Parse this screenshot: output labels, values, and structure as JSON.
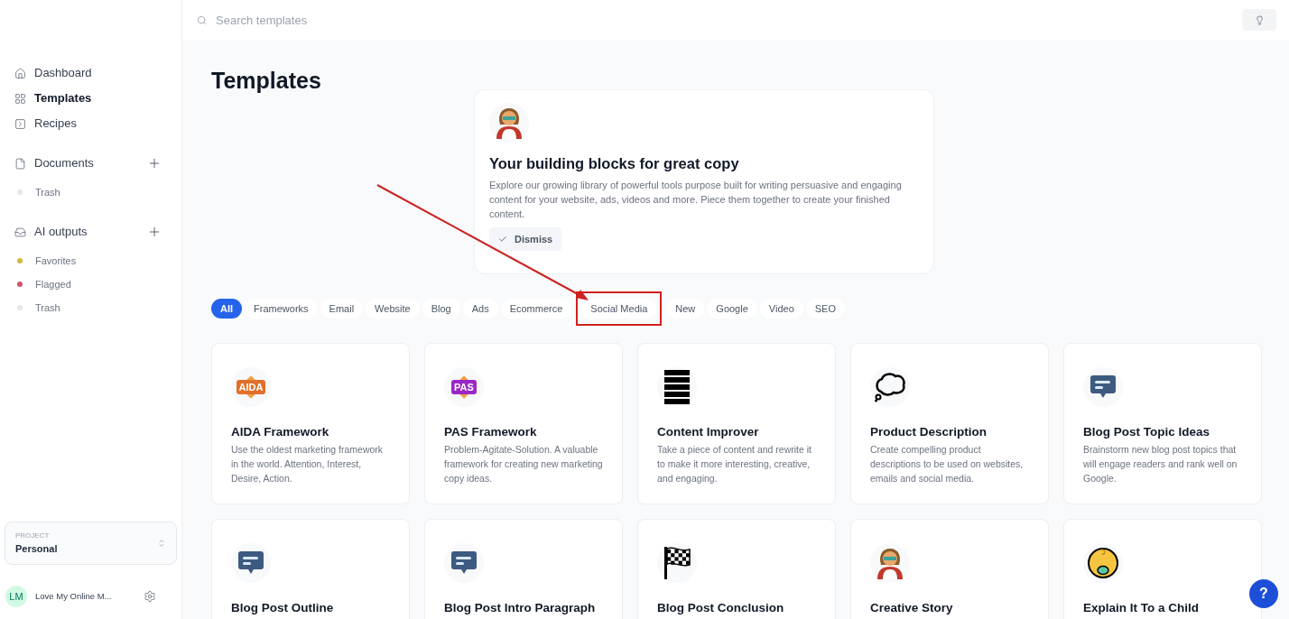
{
  "search": {
    "placeholder": "Search templates"
  },
  "sidebar": {
    "nav": [
      {
        "label": "Dashboard",
        "kind": "home",
        "selected": false
      },
      {
        "label": "Templates",
        "kind": "grid",
        "selected": true
      },
      {
        "label": "Recipes",
        "kind": "recipe",
        "selected": false
      }
    ],
    "sections": [
      {
        "title": "Documents",
        "kind": "file",
        "items": [
          {
            "label": "Trash",
            "color": "#e5e7eb"
          }
        ]
      },
      {
        "title": "AI outputs",
        "kind": "inbox",
        "items": [
          {
            "label": "Favorites",
            "color": "#d4b43c"
          },
          {
            "label": "Flagged",
            "color": "#d4536a"
          },
          {
            "label": "Trash",
            "color": "#e5e7eb"
          }
        ]
      }
    ],
    "project": {
      "label": "PROJECT",
      "value": "Personal"
    },
    "user": {
      "initials": "LM",
      "name": "Love My Online M..."
    }
  },
  "page_title": "Templates",
  "banner": {
    "title": "Your building blocks for great copy",
    "text": "Explore our growing library of powerful tools purpose built for writing persuasive and engaging content for your website, ads, videos and more. Piece them together to create your finished content.",
    "button": "Dismiss"
  },
  "filters": [
    {
      "label": "All",
      "selected": true,
      "highlighted": false
    },
    {
      "label": "Frameworks",
      "selected": false,
      "highlighted": false
    },
    {
      "label": "Email",
      "selected": false,
      "highlighted": false
    },
    {
      "label": "Website",
      "selected": false,
      "highlighted": false
    },
    {
      "label": "Blog",
      "selected": false,
      "highlighted": false
    },
    {
      "label": "Ads",
      "selected": false,
      "highlighted": false
    },
    {
      "label": "Ecommerce",
      "selected": false,
      "highlighted": false
    },
    {
      "label": "Social Media",
      "selected": false,
      "highlighted": true
    },
    {
      "label": "New",
      "selected": false,
      "highlighted": false
    },
    {
      "label": "Google",
      "selected": false,
      "highlighted": false
    },
    {
      "label": "Video",
      "selected": false,
      "highlighted": false
    },
    {
      "label": "SEO",
      "selected": false,
      "highlighted": false
    }
  ],
  "templates": [
    {
      "kind": "badge",
      "badge": "AIDA",
      "color": "#e0702a",
      "title": "AIDA Framework",
      "text": "Use the oldest marketing framework in the world. Attention, Interest, Desire, Action."
    },
    {
      "kind": "badge",
      "badge": "PAS",
      "color": "#9b27c9",
      "title": "PAS Framework",
      "text": "Problem-Agitate-Solution. A valuable framework for creating new marketing copy ideas."
    },
    {
      "kind": "lines",
      "title": "Content Improver",
      "text": "Take a piece of content and rewrite it to make it more interesting, creative, and engaging."
    },
    {
      "kind": "thought",
      "title": "Product Description",
      "text": "Create compelling product descriptions to be used on websites, emails and social media."
    },
    {
      "kind": "chat",
      "title": "Blog Post Topic Ideas",
      "text": "Brainstorm new blog post topics that will engage readers and rank well on Google."
    },
    {
      "kind": "chat",
      "title": "Blog Post Outline"
    },
    {
      "kind": "chat",
      "title": "Blog Post Intro Paragraph"
    },
    {
      "kind": "flag",
      "title": "Blog Post Conclusion"
    },
    {
      "kind": "hero",
      "title": "Creative Story"
    },
    {
      "kind": "baby",
      "title": "Explain It To a Child"
    }
  ],
  "help_button": "?"
}
